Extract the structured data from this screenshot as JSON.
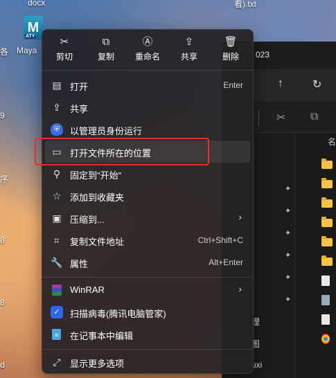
{
  "desktop": {
    "top_left_text": "docx",
    "top_right_text": "看).txt",
    "app_icon_letter": "M",
    "app_icon_badge": "ATY",
    "app_label": "Maya",
    "left_edge_labels": [
      "各",
      "9",
      "序",
      "8",
      "8",
      "d"
    ]
  },
  "explorer": {
    "title": "023",
    "column_header": "名",
    "nav_items": [
      "理",
      "图",
      "uxi"
    ]
  },
  "context_menu": {
    "quick_actions": [
      {
        "label": "剪切",
        "icon": "scissors-icon",
        "glyph": "✂"
      },
      {
        "label": "复制",
        "icon": "copy-icon",
        "glyph": "⧉"
      },
      {
        "label": "重命名",
        "icon": "rename-icon",
        "glyph": "Ⓐ"
      },
      {
        "label": "共享",
        "icon": "share-icon",
        "glyph": "⇪"
      },
      {
        "label": "删除",
        "icon": "trash-icon",
        "glyph": "🗑"
      }
    ],
    "items": [
      {
        "label": "打开",
        "shortcut": "Enter",
        "icon": "document-icon",
        "glyph": "▤"
      },
      {
        "label": "共享",
        "shortcut": "",
        "icon": "share-icon",
        "glyph": "⇪"
      },
      {
        "label": "以管理员身份运行",
        "shortcut": "",
        "icon": "admin-shield-icon",
        "glyph": "⛨"
      },
      {
        "label": "打开文件所在的位置",
        "shortcut": "",
        "icon": "folder-open-icon",
        "glyph": "▭"
      },
      {
        "label": "固定到\"开始\"",
        "shortcut": "",
        "icon": "pin-icon",
        "glyph": "⚲"
      },
      {
        "label": "添加到收藏夹",
        "shortcut": "",
        "icon": "star-icon",
        "glyph": "☆"
      },
      {
        "label": "压缩到...",
        "shortcut": "",
        "icon": "zip-folder-icon",
        "glyph": "▣"
      },
      {
        "label": "复制文件地址",
        "shortcut": "Ctrl+Shift+C",
        "icon": "copy-path-icon",
        "glyph": "⌗"
      },
      {
        "label": "属性",
        "shortcut": "Alt+Enter",
        "icon": "wrench-icon",
        "glyph": "🔧"
      },
      {
        "label": "WinRAR",
        "shortcut": "",
        "icon": "winrar-icon",
        "glyph": ""
      },
      {
        "label": "扫描病毒(腾讯电脑管家)",
        "shortcut": "",
        "icon": "tencent-shield-icon",
        "glyph": "✓"
      },
      {
        "label": "在记事本中编辑",
        "shortcut": "",
        "icon": "notepad-icon",
        "glyph": "≡"
      },
      {
        "label": "显示更多选项",
        "shortcut": "",
        "icon": "more-options-icon",
        "glyph": "⤢"
      }
    ],
    "submenu_arrow": "›",
    "highlight_color": "#e4322b"
  }
}
